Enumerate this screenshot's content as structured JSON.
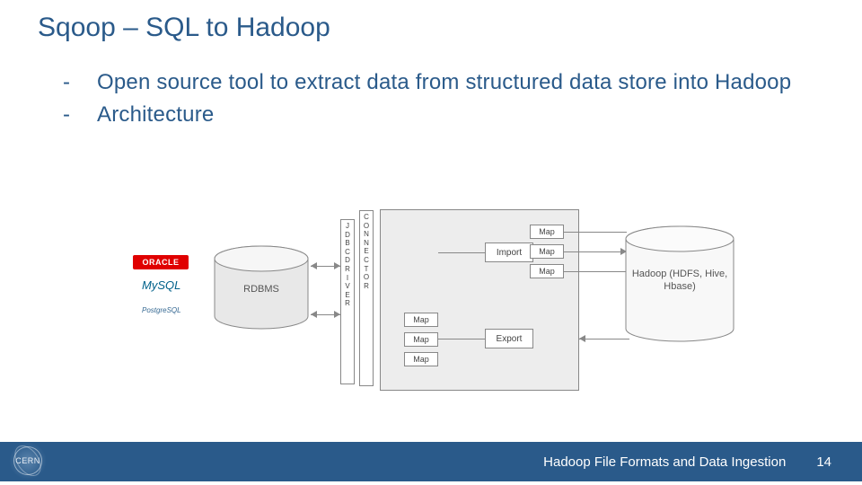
{
  "title": "Sqoop – SQL to Hadoop",
  "bullets": [
    "Open source tool to extract data from structured data store into Hadoop",
    "Architecture"
  ],
  "diagram": {
    "logos": {
      "oracle": "ORACLE",
      "mysql": "MySQL",
      "postgres": "PostgreSQL"
    },
    "rdbms": "RDBMS",
    "jdbc_driver": [
      "J",
      "D",
      "B",
      "C",
      "D",
      "R",
      "I",
      "V",
      "E",
      "R"
    ],
    "connector": [
      "C",
      "O",
      "N",
      "N",
      "E",
      "C",
      "T",
      "O",
      "R"
    ],
    "import": "Import",
    "export": "Export",
    "map": "Map",
    "hadoop": "Hadoop (HDFS, Hive, Hbase)"
  },
  "footer": {
    "text": "Hadoop File Formats and Data Ingestion",
    "page": "14"
  },
  "badge": "CERN"
}
